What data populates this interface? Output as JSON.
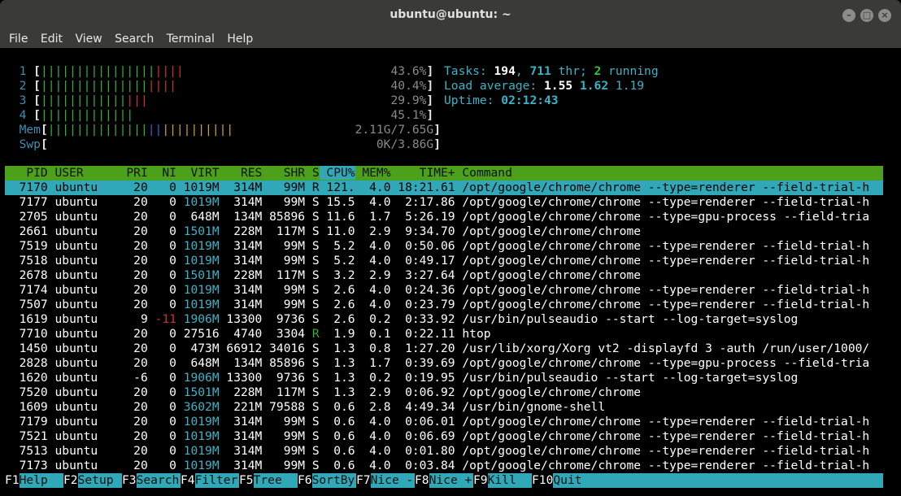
{
  "window": {
    "title": "ubuntu@ubuntu: ~"
  },
  "menu": [
    "File",
    "Edit",
    "View",
    "Search",
    "Terminal",
    "Help"
  ],
  "meters": {
    "cpus": [
      {
        "id": "1",
        "percent": "43.6%"
      },
      {
        "id": "2",
        "percent": "40.4%"
      },
      {
        "id": "3",
        "percent": "29.9%"
      },
      {
        "id": "4",
        "percent": "45.1%"
      }
    ],
    "mem": {
      "label": "Mem",
      "value": "2.11G/7.65G"
    },
    "swp": {
      "label": "Swp",
      "value": "0K/3.86G"
    }
  },
  "summary": {
    "tasks_label": "Tasks: ",
    "tasks": "194",
    "thr": "711",
    "thr_label": " thr; ",
    "running": "2",
    "running_label": " running",
    "load_label": "Load average: ",
    "load1": "1.55",
    "load5": "1.62",
    "load15": "1.19",
    "uptime_label": "Uptime: ",
    "uptime": "02:12:43"
  },
  "columns": [
    "PID",
    "USER",
    "PRI",
    "NI",
    "VIRT",
    "RES",
    "SHR",
    "S",
    "CPU%",
    "MEM%",
    "TIME+",
    "Command"
  ],
  "processes": [
    {
      "pid": "7170",
      "user": "ubuntu",
      "pri": "20",
      "ni": "0",
      "virt": "1019M",
      "res": "314M",
      "shr": "99M",
      "s": "R",
      "cpu": "121.",
      "mem": "4.0",
      "time": "18:21.61",
      "cmd": "/opt/google/chrome/chrome --type=renderer --field-trial-h"
    },
    {
      "pid": "7177",
      "user": "ubuntu",
      "pri": "20",
      "ni": "0",
      "virt": "1019M",
      "res": "314M",
      "shr": "99M",
      "s": "S",
      "cpu": "15.5",
      "mem": "4.0",
      "time": "2:17.86",
      "cmd": "/opt/google/chrome/chrome --type=renderer --field-trial-h"
    },
    {
      "pid": "2705",
      "user": "ubuntu",
      "pri": "20",
      "ni": "0",
      "virt": "648M",
      "res": "134M",
      "shr": "85896",
      "s": "S",
      "cpu": "11.6",
      "mem": "1.7",
      "time": "5:26.19",
      "cmd": "/opt/google/chrome/chrome --type=gpu-process --field-tria"
    },
    {
      "pid": "2661",
      "user": "ubuntu",
      "pri": "20",
      "ni": "0",
      "virt": "1501M",
      "res": "228M",
      "shr": "117M",
      "s": "S",
      "cpu": "11.0",
      "mem": "2.9",
      "time": "9:34.70",
      "cmd": "/opt/google/chrome/chrome"
    },
    {
      "pid": "7519",
      "user": "ubuntu",
      "pri": "20",
      "ni": "0",
      "virt": "1019M",
      "res": "314M",
      "shr": "99M",
      "s": "S",
      "cpu": "5.2",
      "mem": "4.0",
      "time": "0:50.06",
      "cmd": "/opt/google/chrome/chrome --type=renderer --field-trial-h"
    },
    {
      "pid": "7518",
      "user": "ubuntu",
      "pri": "20",
      "ni": "0",
      "virt": "1019M",
      "res": "314M",
      "shr": "99M",
      "s": "S",
      "cpu": "5.2",
      "mem": "4.0",
      "time": "0:49.17",
      "cmd": "/opt/google/chrome/chrome --type=renderer --field-trial-h"
    },
    {
      "pid": "2678",
      "user": "ubuntu",
      "pri": "20",
      "ni": "0",
      "virt": "1501M",
      "res": "228M",
      "shr": "117M",
      "s": "S",
      "cpu": "3.2",
      "mem": "2.9",
      "time": "3:27.64",
      "cmd": "/opt/google/chrome/chrome"
    },
    {
      "pid": "7174",
      "user": "ubuntu",
      "pri": "20",
      "ni": "0",
      "virt": "1019M",
      "res": "314M",
      "shr": "99M",
      "s": "S",
      "cpu": "2.6",
      "mem": "4.0",
      "time": "0:24.36",
      "cmd": "/opt/google/chrome/chrome --type=renderer --field-trial-h"
    },
    {
      "pid": "7507",
      "user": "ubuntu",
      "pri": "20",
      "ni": "0",
      "virt": "1019M",
      "res": "314M",
      "shr": "99M",
      "s": "S",
      "cpu": "2.6",
      "mem": "4.0",
      "time": "0:23.79",
      "cmd": "/opt/google/chrome/chrome --type=renderer --field-trial-h"
    },
    {
      "pid": "1619",
      "user": "ubuntu",
      "pri": "9",
      "ni": "-11",
      "virt": "1906M",
      "res": "13300",
      "shr": "9736",
      "s": "S",
      "cpu": "2.6",
      "mem": "0.2",
      "time": "0:33.92",
      "cmd": "/usr/bin/pulseaudio --start --log-target=syslog"
    },
    {
      "pid": "7710",
      "user": "ubuntu",
      "pri": "20",
      "ni": "0",
      "virt": "27516",
      "res": "4740",
      "shr": "3304",
      "s": "R",
      "cpu": "1.9",
      "mem": "0.1",
      "time": "0:22.11",
      "cmd": "htop"
    },
    {
      "pid": "1450",
      "user": "ubuntu",
      "pri": "20",
      "ni": "0",
      "virt": "473M",
      "res": "66912",
      "shr": "34016",
      "s": "S",
      "cpu": "1.3",
      "mem": "0.8",
      "time": "1:27.20",
      "cmd": "/usr/lib/xorg/Xorg vt2 -displayfd 3 -auth /run/user/1000/"
    },
    {
      "pid": "2828",
      "user": "ubuntu",
      "pri": "20",
      "ni": "0",
      "virt": "648M",
      "res": "134M",
      "shr": "85896",
      "s": "S",
      "cpu": "1.3",
      "mem": "1.7",
      "time": "0:39.69",
      "cmd": "/opt/google/chrome/chrome --type=gpu-process --field-tria"
    },
    {
      "pid": "1620",
      "user": "ubuntu",
      "pri": "-6",
      "ni": "0",
      "virt": "1906M",
      "res": "13300",
      "shr": "9736",
      "s": "S",
      "cpu": "1.3",
      "mem": "0.2",
      "time": "0:19.95",
      "cmd": "/usr/bin/pulseaudio --start --log-target=syslog"
    },
    {
      "pid": "7520",
      "user": "ubuntu",
      "pri": "20",
      "ni": "0",
      "virt": "1501M",
      "res": "228M",
      "shr": "117M",
      "s": "S",
      "cpu": "1.3",
      "mem": "2.9",
      "time": "0:06.92",
      "cmd": "/opt/google/chrome/chrome"
    },
    {
      "pid": "1609",
      "user": "ubuntu",
      "pri": "20",
      "ni": "0",
      "virt": "3602M",
      "res": "221M",
      "shr": "79588",
      "s": "S",
      "cpu": "0.6",
      "mem": "2.8",
      "time": "4:49.34",
      "cmd": "/usr/bin/gnome-shell"
    },
    {
      "pid": "7179",
      "user": "ubuntu",
      "pri": "20",
      "ni": "0",
      "virt": "1019M",
      "res": "314M",
      "shr": "99M",
      "s": "S",
      "cpu": "0.6",
      "mem": "4.0",
      "time": "0:06.01",
      "cmd": "/opt/google/chrome/chrome --type=renderer --field-trial-h"
    },
    {
      "pid": "7521",
      "user": "ubuntu",
      "pri": "20",
      "ni": "0",
      "virt": "1019M",
      "res": "314M",
      "shr": "99M",
      "s": "S",
      "cpu": "0.6",
      "mem": "4.0",
      "time": "0:06.69",
      "cmd": "/opt/google/chrome/chrome --type=renderer --field-trial-h"
    },
    {
      "pid": "7513",
      "user": "ubuntu",
      "pri": "20",
      "ni": "0",
      "virt": "1019M",
      "res": "314M",
      "shr": "99M",
      "s": "S",
      "cpu": "0.6",
      "mem": "4.0",
      "time": "0:01.80",
      "cmd": "/opt/google/chrome/chrome --type=renderer --field-trial-h"
    },
    {
      "pid": "7173",
      "user": "ubuntu",
      "pri": "20",
      "ni": "0",
      "virt": "1019M",
      "res": "314M",
      "shr": "99M",
      "s": "S",
      "cpu": "0.6",
      "mem": "4.0",
      "time": "0:03.84",
      "cmd": "/opt/google/chrome/chrome --type=renderer --field-trial-h"
    }
  ],
  "function_keys": [
    {
      "key": "F1",
      "label": "Help"
    },
    {
      "key": "F2",
      "label": "Setup"
    },
    {
      "key": "F3",
      "label": "Search"
    },
    {
      "key": "F4",
      "label": "Filter"
    },
    {
      "key": "F5",
      "label": "Tree"
    },
    {
      "key": "F6",
      "label": "SortBy"
    },
    {
      "key": "F7",
      "label": "Nice -"
    },
    {
      "key": "F8",
      "label": "Nice +"
    },
    {
      "key": "F9",
      "label": "Kill"
    },
    {
      "key": "F10",
      "label": "Quit"
    }
  ],
  "colors": {
    "header_bg": "#4ca01a",
    "selection_bg": "#30a8b8",
    "cpu_label": "#3c8fb5",
    "bar_green": "#33b03a",
    "bar_red": "#d03030",
    "bar_blue": "#3464c8",
    "bar_yellow": "#c8a822"
  }
}
